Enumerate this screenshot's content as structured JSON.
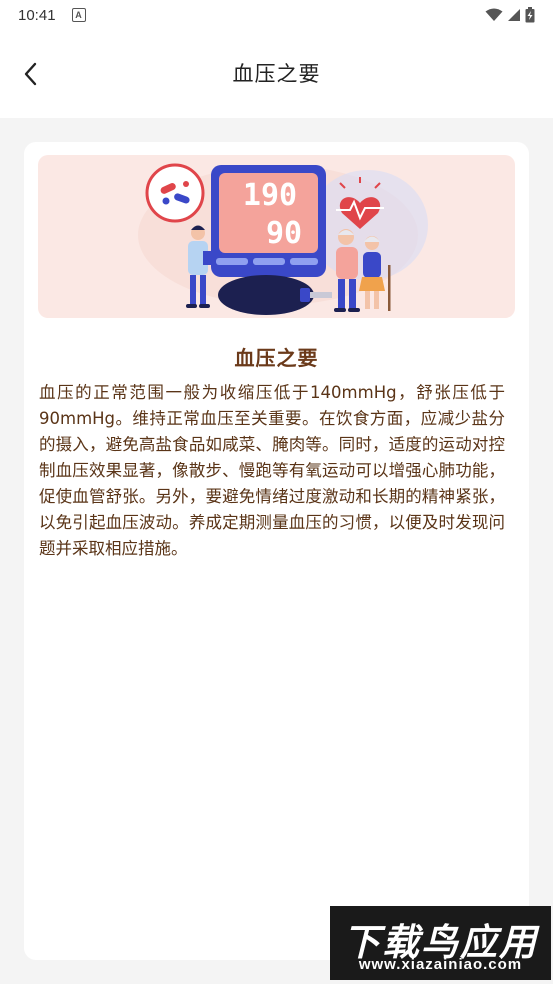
{
  "status_bar": {
    "time": "10:41",
    "notification_badge": "A",
    "icons": [
      "wifi-icon",
      "signal-icon",
      "battery-charging-icon"
    ]
  },
  "nav": {
    "back_icon": "chevron-left-icon",
    "title": "血压之要"
  },
  "article": {
    "banner": {
      "monitor_systolic": "190",
      "monitor_diastolic": "90",
      "illustration_icons": [
        "pills-icon",
        "heart-pulse-icon",
        "doctor-figure",
        "elderly-couple-figure",
        "pressure-bulb-icon"
      ]
    },
    "title": "血压之要",
    "body": "血压的正常范围一般为收缩压低于140mmHg，舒张压低于90mmHg。维持正常血压至关重要。在饮食方面，应减少盐分的摄入，避免高盐食品如咸菜、腌肉等。同时，适度的运动对控制血压效果显著，像散步、慢跑等有氧运动可以增强心肺功能，促使血管舒张。另外，要避免情绪过度激动和长期的精神紧张，以免引起血压波动。养成定期测量血压的习惯，以便及时发现问题并采取相应措施。"
  },
  "watermark": {
    "name": "下载鸟应用",
    "url": "www.xiazainiao.com"
  },
  "colors": {
    "accent_brown": "#6b3a1a",
    "body_text": "#5a3417",
    "banner_bg": "#fbe8e4",
    "monitor_blue": "#3a48c8",
    "heart_red": "#e0454a"
  }
}
